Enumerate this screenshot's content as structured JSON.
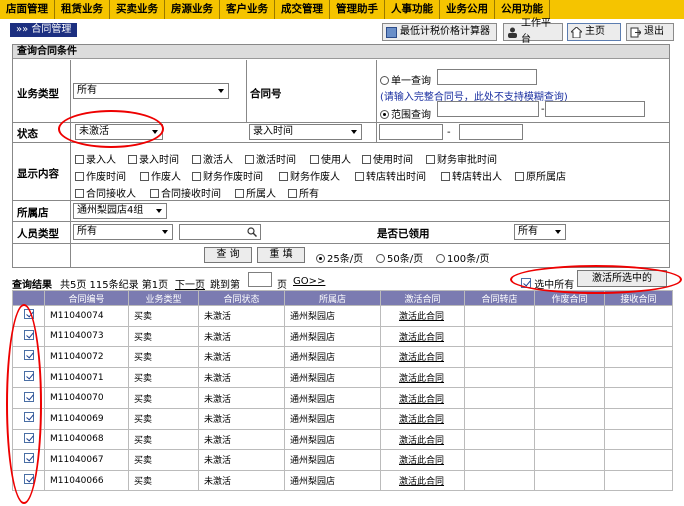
{
  "topnav": [
    "店面管理",
    "租赁业务",
    "买卖业务",
    "房源业务",
    "客户业务",
    "成交管理",
    "管理助手",
    "人事功能",
    "业务公用",
    "公用功能"
  ],
  "breadcrumb": "»» 合同管理",
  "toolbar": {
    "calc": "最低计税价格计算器",
    "workbench": "工作平台",
    "home": "主页",
    "exit": "退出"
  },
  "query": {
    "title": "查询合同条件",
    "biz_type_label": "业务类型",
    "biz_type_value": "所有",
    "contract_no_label": "合同号",
    "single_query": "单一查询",
    "single_hint": "(请输入完整合同号，此处不支持模糊查询)",
    "range_query": "范围查询",
    "range_sep": "-",
    "status_label": "状态",
    "status_value": "未激活",
    "time_field_value": "录入时间",
    "date_sep": "-",
    "display_label": "显示内容",
    "display_options": [
      "录入人",
      "录入时间",
      "激活人",
      "激活时间",
      "使用人",
      "使用时间",
      "财务审批时间",
      "作废时间",
      "作废人",
      "财务作废时间",
      "财务作废人",
      "转店转出时间",
      "转店转出人",
      "原所属店",
      "合同接收人",
      "合同接收时间",
      "所属人",
      "所有"
    ],
    "store_label": "所属店",
    "store_value": "通州梨园店4组",
    "person_type_label": "人员类型",
    "person_type_value": "所有",
    "collected_label": "是否已领用",
    "collected_value": "所有",
    "search_btn": "查 询",
    "reset_btn": "重 填",
    "page_sizes": [
      "25条/页",
      "50条/页",
      "100条/页"
    ]
  },
  "results": {
    "title": "查询结果",
    "summary": "共5页 115条纪录 第1页",
    "next": "下一页",
    "jump": "跳到第",
    "page_unit": "页",
    "go": "GO>>",
    "select_all": "选中所有",
    "activate_selected": "激活所选中的",
    "columns": [
      "",
      "合同编号",
      "业务类型",
      "合同状态",
      "所属店",
      "激活合同",
      "合同转店",
      "作废合同",
      "接收合同"
    ],
    "rows": [
      {
        "no": "M11040074",
        "type": "买卖",
        "status": "未激活",
        "store": "通州梨园店",
        "action": "激活此合同"
      },
      {
        "no": "M11040073",
        "type": "买卖",
        "status": "未激活",
        "store": "通州梨园店",
        "action": "激活此合同"
      },
      {
        "no": "M11040072",
        "type": "买卖",
        "status": "未激活",
        "store": "通州梨园店",
        "action": "激活此合同"
      },
      {
        "no": "M11040071",
        "type": "买卖",
        "status": "未激活",
        "store": "通州梨园店",
        "action": "激活此合同"
      },
      {
        "no": "M11040070",
        "type": "买卖",
        "status": "未激活",
        "store": "通州梨园店",
        "action": "激活此合同"
      },
      {
        "no": "M11040069",
        "type": "买卖",
        "status": "未激活",
        "store": "通州梨园店",
        "action": "激活此合同"
      },
      {
        "no": "M11040068",
        "type": "买卖",
        "status": "未激活",
        "store": "通州梨园店",
        "action": "激活此合同"
      },
      {
        "no": "M11040067",
        "type": "买卖",
        "status": "未激活",
        "store": "通州梨园店",
        "action": "激活此合同"
      },
      {
        "no": "M11040066",
        "type": "买卖",
        "status": "未激活",
        "store": "通州梨园店",
        "action": "激活此合同"
      }
    ]
  },
  "colors": {
    "nav": "#f5c400",
    "header": "#7b7bb1",
    "crumb": "#1c2f80",
    "annotation": "#e00000"
  }
}
